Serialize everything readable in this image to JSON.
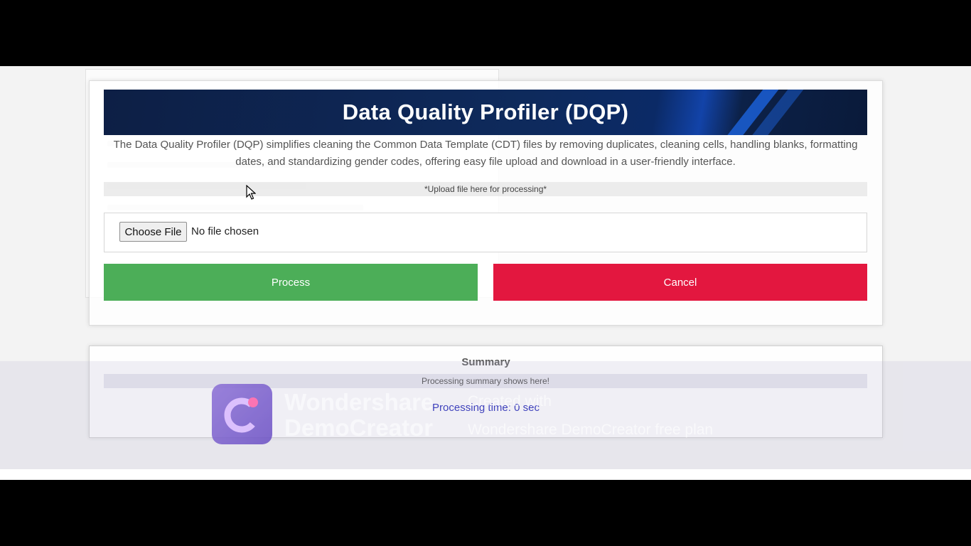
{
  "app": {
    "title": "Data Quality Profiler (DQP)",
    "description": "The Data Quality Profiler (DQP) simplifies cleaning the Common Data Template (CDT) files by removing duplicates, cleaning cells, handling blanks, formatting dates, and standardizing gender codes, offering easy file upload and download in a user-friendly interface."
  },
  "upload": {
    "hint": "*Upload file here for processing*",
    "choose_label": "Choose File",
    "file_status": "No file chosen"
  },
  "actions": {
    "process_label": "Process",
    "cancel_label": "Cancel"
  },
  "summary": {
    "title": "Summary",
    "hint": "Processing summary shows here!",
    "processing_time": "Processing time: 0 sec"
  },
  "watermark": {
    "brand_line1": "Wondershare",
    "brand_line2": "DemoCreator",
    "created_with": "Created with",
    "plan": "Wondershare DemoCreator free plan"
  },
  "colors": {
    "process": "#4cae58",
    "cancel": "#e3173f",
    "banner": "#0e2a5c",
    "processing_time": "#1a1fb5"
  }
}
